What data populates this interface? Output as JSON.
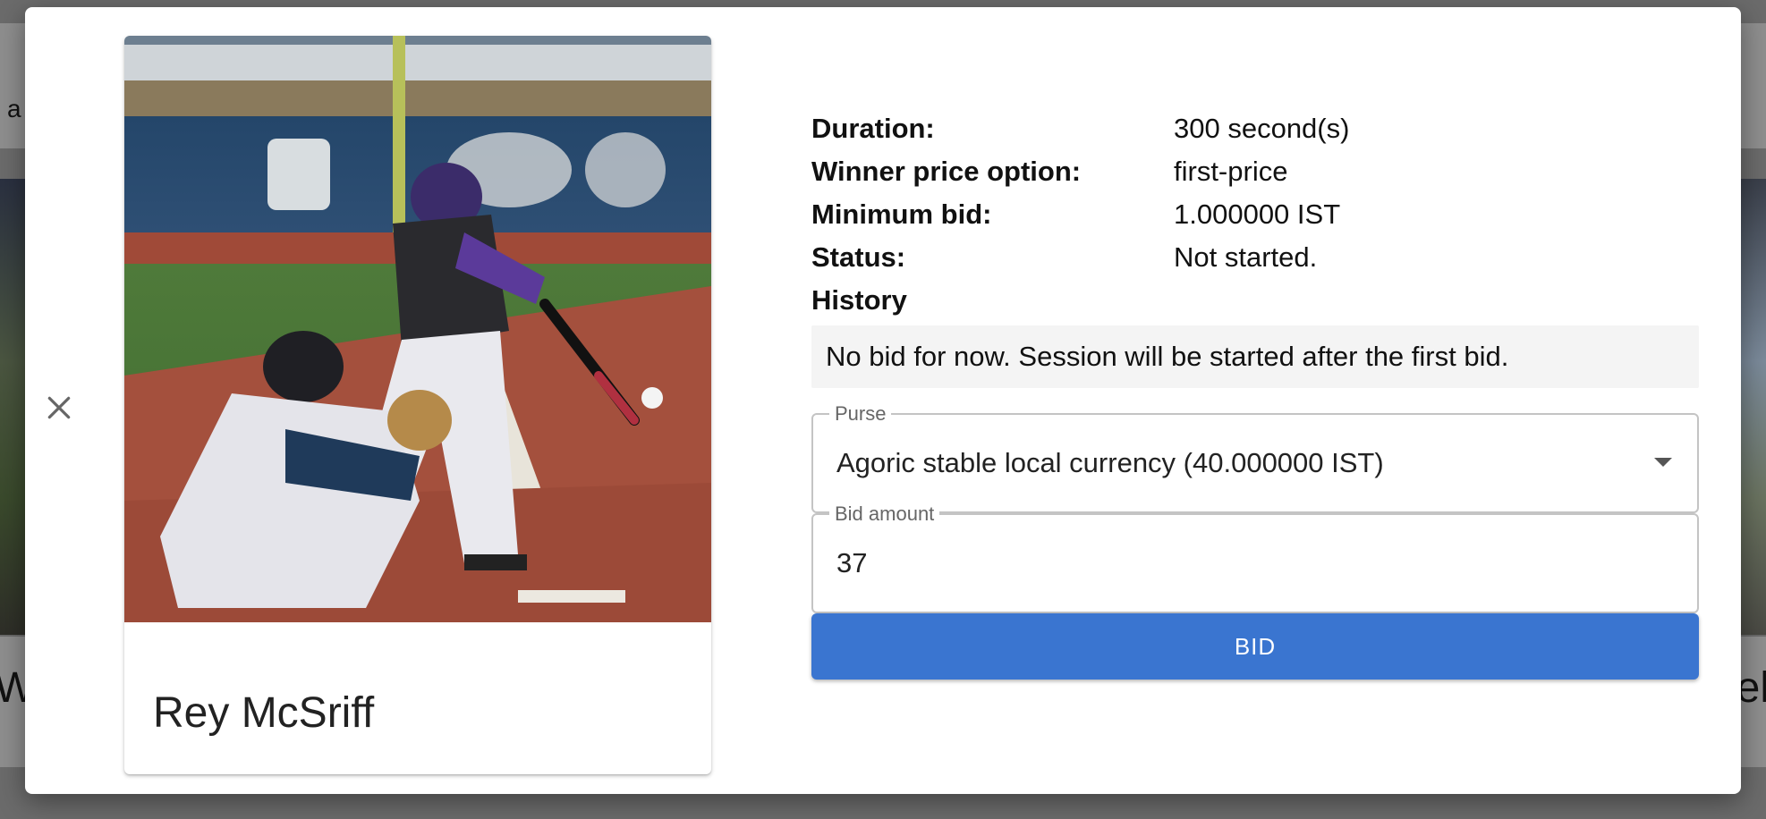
{
  "background": {
    "topbar_text": "a",
    "bottom_left_text": "W",
    "bottom_right_text": "el"
  },
  "modal": {
    "close_icon": "close-icon",
    "card": {
      "title": "Rey McSriff",
      "image": "baseball-batter-photo"
    },
    "details": [
      {
        "label": "Duration:",
        "value": "300 second(s)"
      },
      {
        "label": "Winner price option:",
        "value": "first-price"
      },
      {
        "label": "Minimum bid:",
        "value": "1.000000 IST"
      },
      {
        "label": "Status:",
        "value": "Not started."
      }
    ],
    "history": {
      "heading": "History",
      "message": "No bid for now. Session will be started after the first bid."
    },
    "purse": {
      "label": "Purse",
      "selected": "Agoric stable local currency (40.000000 IST)",
      "icon": "dropdown-arrow-icon"
    },
    "bid_amount": {
      "label": "Bid amount",
      "value": "37"
    },
    "bid_button": "BID",
    "colors": {
      "button": "#3a75d0",
      "history_bg": "#f4f4f4"
    }
  }
}
